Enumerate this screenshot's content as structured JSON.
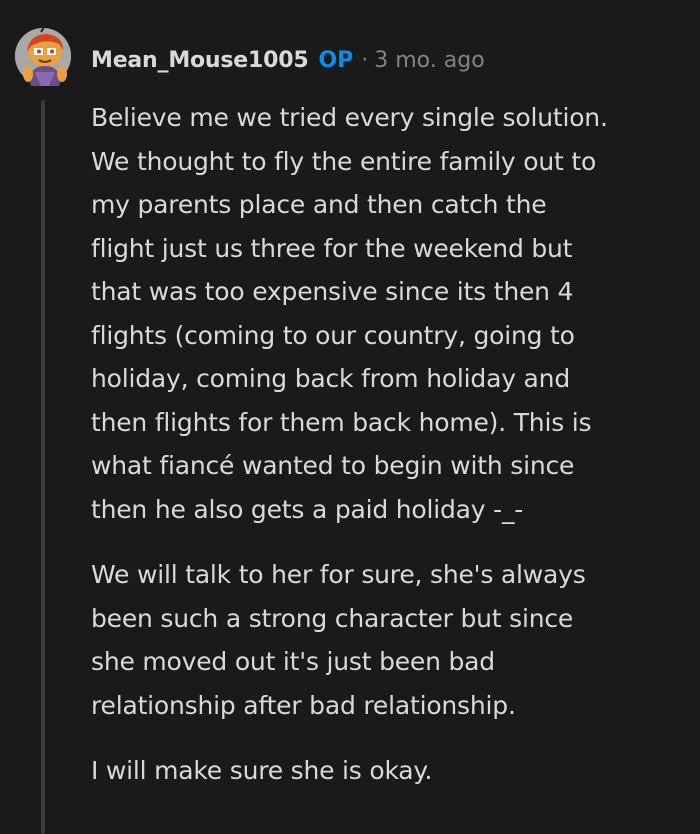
{
  "comment": {
    "author": "Mean_Mouse1005",
    "badge": "OP",
    "separator": "·",
    "timestamp": "3 mo. ago",
    "paragraphs": [
      [
        "Believe me we tried every single solution.",
        "We thought to fly the entire family out to",
        "my parents place and then catch the",
        "flight just us three for the weekend but",
        "that was too expensive since its then 4",
        "flights (coming to our country, going to",
        "holiday, coming back from holiday and",
        "then flights for them back home). This is",
        "what fiancé wanted to begin with since",
        "then he also gets a paid holiday -_-"
      ],
      [
        "We will talk to her for sure, she's always",
        "been such a strong character but since",
        "she moved out it's just been bad",
        "relationship after bad relationship."
      ],
      [
        "I will make sure she is okay."
      ]
    ]
  },
  "colors": {
    "background": "#1a1a1b",
    "text": "#d7dadc",
    "muted": "#818384",
    "op_badge": "#0d8be8",
    "thread_line": "#3a3a3c"
  },
  "icons": {
    "avatar": "snoo-avatar-icon"
  }
}
